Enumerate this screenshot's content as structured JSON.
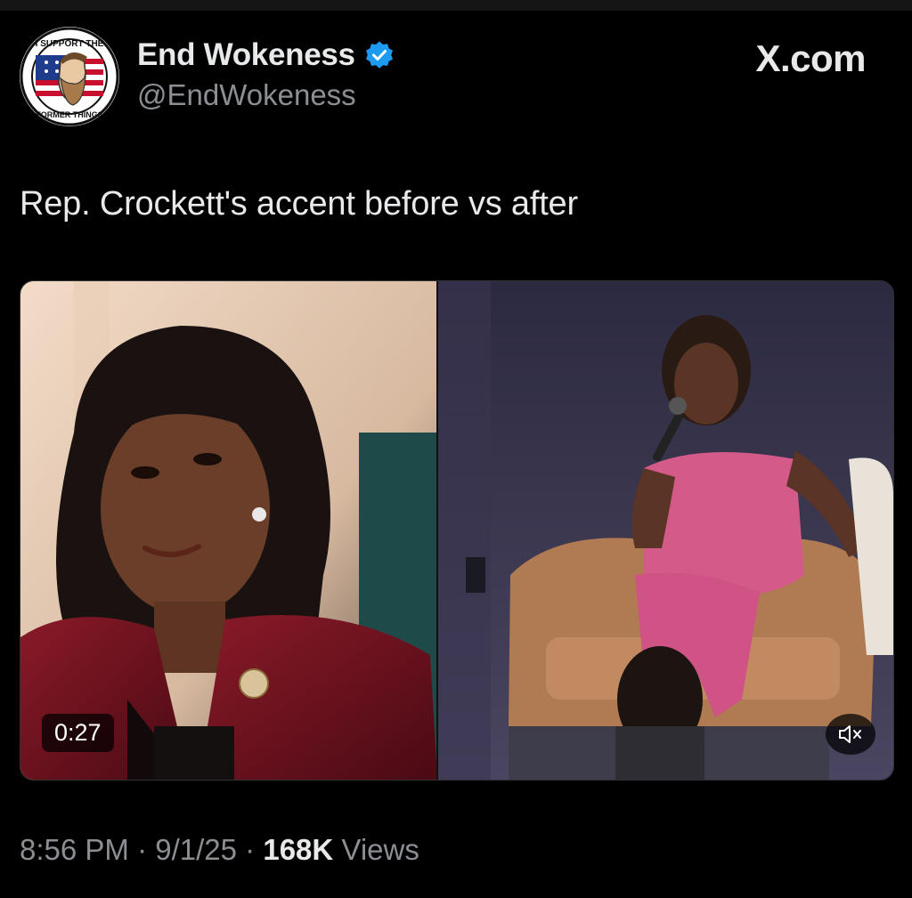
{
  "account": {
    "display_name": "End Wokeness",
    "handle": "@EndWokeness",
    "verified": true,
    "avatar_text_top": "I SUPPORT THE",
    "avatar_text_bottom": "FORMER THINGS"
  },
  "site_label": "X.com",
  "post": {
    "text": "Rep. Crockett's accent before vs after",
    "video_duration": "0:27",
    "muted": true
  },
  "meta": {
    "time": "8:56 PM",
    "separator": "·",
    "date": "9/1/25",
    "views_count": "168K",
    "views_label": "Views"
  },
  "colors": {
    "background": "#000000",
    "text_primary": "#e7e9ea",
    "text_secondary": "#8b8f94",
    "verified_badge": "#1d9bf0"
  },
  "icons": {
    "verified": "verified-badge-icon",
    "mute": "volume-muted-icon"
  }
}
